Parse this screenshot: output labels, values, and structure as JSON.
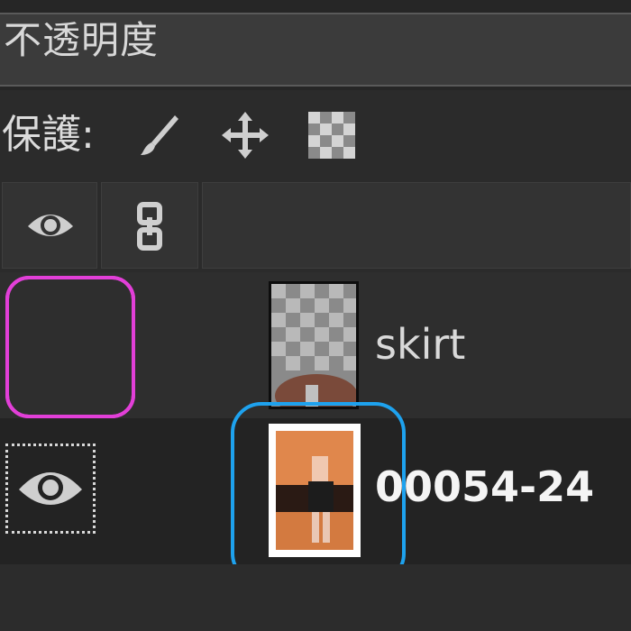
{
  "opacity": {
    "label": "不透明度"
  },
  "protect": {
    "label": "保護:",
    "icons": [
      "brush-icon",
      "move-icon",
      "checkerboard-icon"
    ]
  },
  "header": {
    "columns": [
      "eye-icon",
      "chain-link-icon",
      ""
    ]
  },
  "layers": [
    {
      "name": "skirt",
      "visible": false
    },
    {
      "name": "00054-24",
      "visible": true
    }
  ],
  "colors": {
    "highlight_magenta": "#e23fd8",
    "highlight_blue": "#1ea2ee",
    "panel_bg": "#2b2b2b"
  }
}
